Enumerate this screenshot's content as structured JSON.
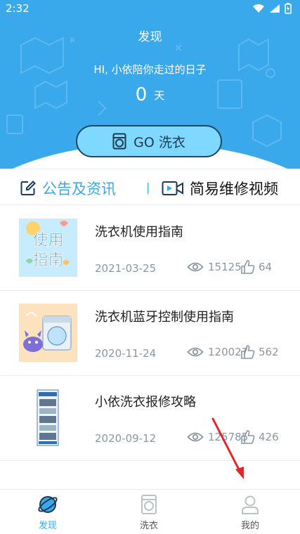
{
  "status_bar": {
    "time": "2:32"
  },
  "hero": {
    "title": "发现",
    "subtitle": "HI, 小依陪你走过的日子",
    "days_count": "0",
    "days_unit": "天",
    "go_button_label": "GO 洗衣"
  },
  "tabs": {
    "news_label": "公告及资讯",
    "separator": "|",
    "video_label": "简易维修视频"
  },
  "thumbnails": {
    "guide_text_line1": "使用",
    "guide_text_line2": "指南"
  },
  "articles": [
    {
      "title": "洗衣机使用指南",
      "date": "2021-03-25",
      "views": "15125",
      "likes": "64"
    },
    {
      "title": "洗衣机蓝牙控制使用指南",
      "date": "2020-11-24",
      "views": "120027",
      "likes": "562"
    },
    {
      "title": "小依洗衣报修攻略",
      "date": "2020-09-12",
      "views": "125785",
      "likes": "426"
    }
  ],
  "bottom_nav": {
    "home_label": "发现",
    "wash_label": "洗衣",
    "mine_label": "我的"
  },
  "colors": {
    "primary": "#3aa9ec",
    "button_fill": "#7ed8ff",
    "annotation_arrow": "#e3262c"
  }
}
